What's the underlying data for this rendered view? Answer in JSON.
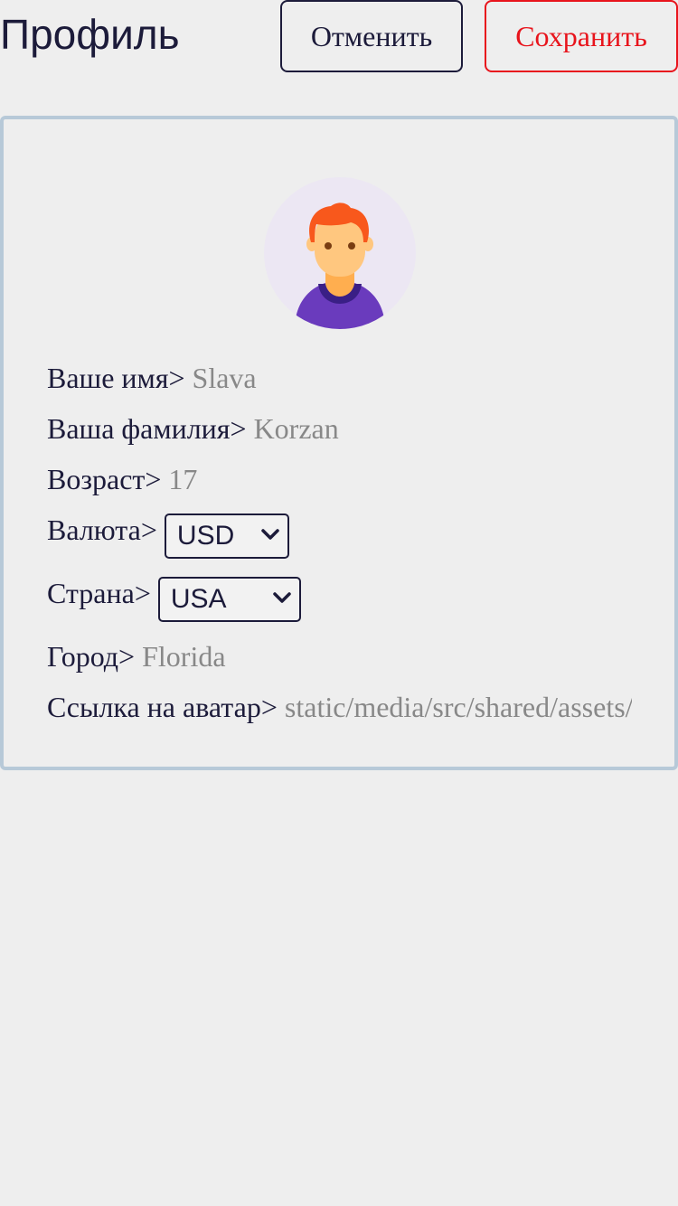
{
  "header": {
    "title": "Профиль",
    "cancel_label": "Отменить",
    "save_label": "Сохранить"
  },
  "colors": {
    "text": "#1c1b3a",
    "save_accent": "#e8141c",
    "card_border": "#b7c9d8",
    "value_text": "#888888",
    "background": "#eeeeee"
  },
  "profile": {
    "avatar_icon": "user-avatar-icon",
    "fields": {
      "first_name": {
        "label": "Ваше имя>",
        "value": "Slava"
      },
      "last_name": {
        "label": "Ваша фамилия>",
        "value": "Korzan"
      },
      "age": {
        "label": "Возраст>",
        "value": "17"
      },
      "currency": {
        "label": "Валюта>",
        "value": "USD"
      },
      "country": {
        "label": "Страна>",
        "value": "USA"
      },
      "city": {
        "label": "Город>",
        "value": "Florida"
      },
      "avatar_link": {
        "label": "Ссылка на аватар>",
        "value": "static/media/src/shared/assets/"
      }
    }
  }
}
